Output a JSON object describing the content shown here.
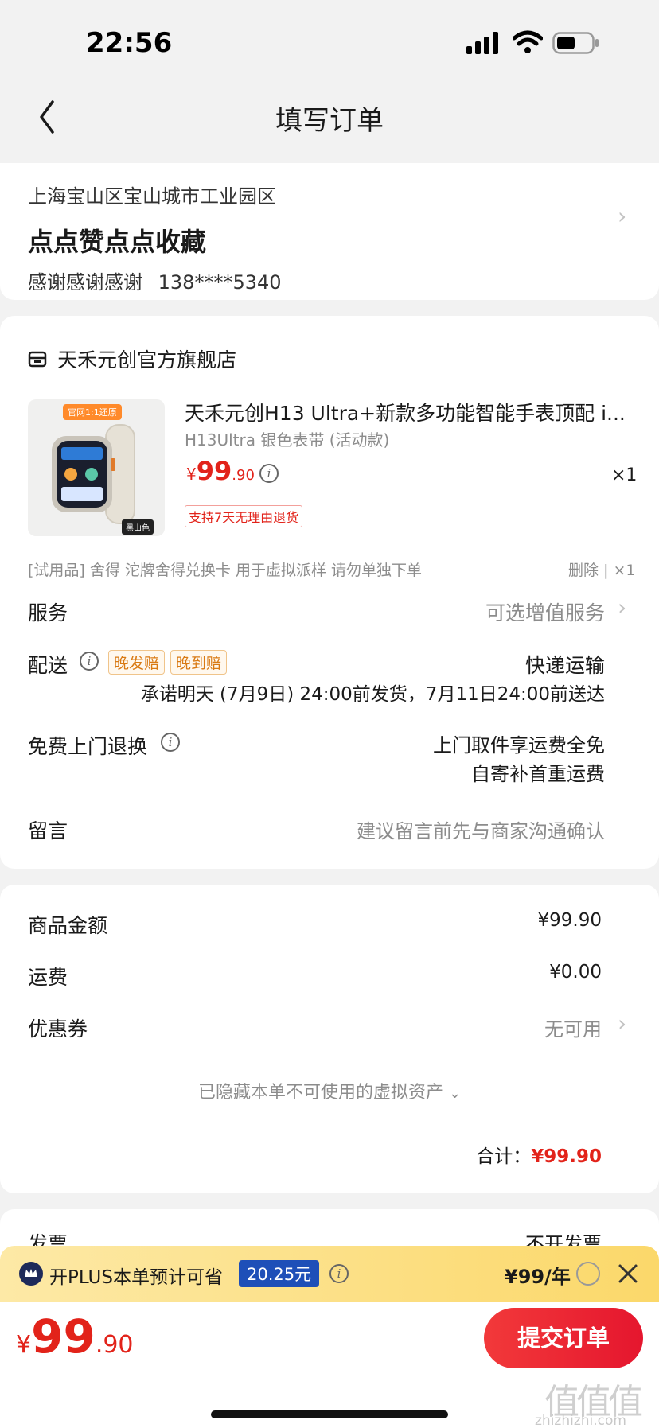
{
  "status_bar": {
    "time": "22:56"
  },
  "header": {
    "title": "填写订单"
  },
  "address": {
    "region": "上海宝山区宝山城市工业园区",
    "detail": "点点赞点点收藏",
    "contact_name": "感谢感谢感谢",
    "phone": "138****5340"
  },
  "shop": {
    "name": "天禾元创官方旗舰店"
  },
  "product": {
    "title": "天禾元创H13 Ultra+新款多功能智能手表顶配 i...",
    "spec": "H13Ultra 银色表带 (活动款)",
    "price_symbol": "¥",
    "price_int": "99",
    "price_dec": ".90",
    "quantity": "×1",
    "return_tag": "支持7天无理由退货",
    "image_badge_top": "官网1:1还原",
    "image_badge_bottom": "黑山色"
  },
  "trial": {
    "text": "[试用品] 舍得 沱牌舍得兑换卡 用于虚拟派样 请勿单独下单",
    "delete": "删除",
    "sep": "|",
    "qty": "×1"
  },
  "service": {
    "label": "服务",
    "value": "可选增值服务"
  },
  "delivery": {
    "label": "配送",
    "tag1": "晚发赔",
    "tag2": "晚到赔",
    "method": "快递运输",
    "promise": "承诺明天 (7月9日) 24:00前发货，7月11日24:00前送达"
  },
  "free_return": {
    "label": "免费上门退换",
    "line1": "上门取件享运费全免",
    "line2": "自寄补首重运费"
  },
  "message": {
    "label": "留言",
    "placeholder": "建议留言前先与商家沟通确认"
  },
  "summary": {
    "goods_label": "商品金额",
    "goods_value": "¥99.90",
    "shipping_label": "运费",
    "shipping_value": "¥0.00",
    "coupon_label": "优惠券",
    "coupon_value": "无可用",
    "hidden_assets": "已隐藏本单不可使用的虚拟资产",
    "total_label": "合计：",
    "total_value": "¥99.90"
  },
  "invoice": {
    "label": "发票",
    "value": "不开发票"
  },
  "plus_bar": {
    "text": "开PLUS本单预计可省",
    "saving": "20.25元",
    "price": "¥99/年"
  },
  "footer": {
    "price_symbol": "¥",
    "price_int": "99",
    "price_dec": ".90",
    "submit": "提交订单"
  },
  "watermark": {
    "logo": "值",
    "site": "zhizhizhi.com"
  },
  "colors": {
    "accent_red": "#e2231a",
    "plus_yellow": "#fbe08a",
    "plus_blue": "#1e4fb8"
  }
}
